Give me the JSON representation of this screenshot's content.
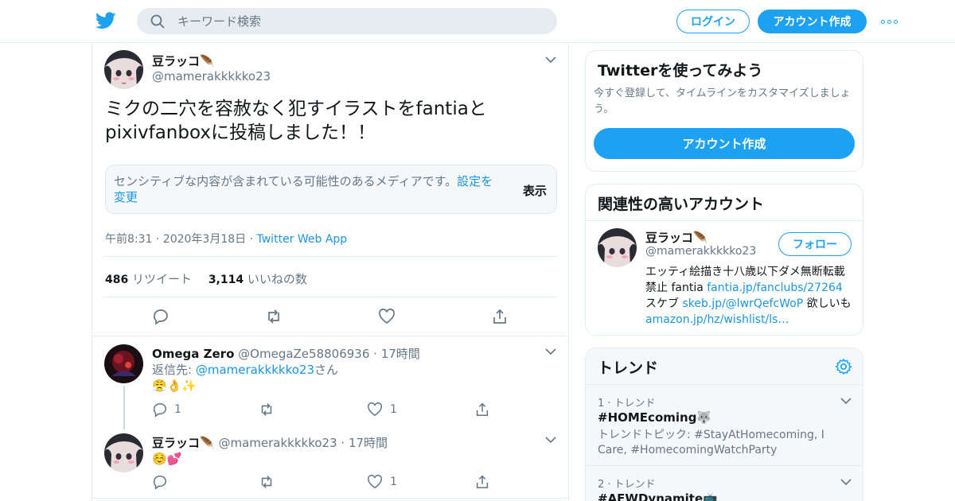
{
  "topbar": {
    "search_placeholder": "キーワード検索",
    "login_label": "ログイン",
    "signup_label": "アカウント作成",
    "accent": "#1da1f2"
  },
  "tweet": {
    "name": "豆ラッコ🪶",
    "handle": "@mamerakkkkko23",
    "text": "ミクの二穴を容赦なく犯すイラストをfantiaとpixivfanboxに投稿しました！！",
    "sensitive_msg": "センシティブな内容が含まれている可能性のあるメディアです。",
    "sensitive_link": "設定を変更",
    "sensitive_show": "表示",
    "time": "午前8:31 · 2020年3月18日",
    "via": "Twitter Web App",
    "retweets": "486",
    "retweets_label": "リツイート",
    "likes": "3,114",
    "likes_label": "いいねの数"
  },
  "replies": [
    {
      "name": "Omega Zero",
      "handle": "@OmegaZe58806936",
      "time": "17時間",
      "reply_prefix": "返信先: ",
      "reply_to": "@mamerakkkkko23",
      "reply_suffix": "さん",
      "text": "😤👌✨",
      "reply_count": "1",
      "like_count": "1"
    },
    {
      "name": "豆ラッコ🪶",
      "handle": "@mamerakkkkko23",
      "time": "17時間",
      "text": "☺️💕",
      "like_count": "1"
    }
  ],
  "signup_card": {
    "title": "Twitterを使ってみよう",
    "sub": "今すぐ登録して、タイムラインをカスタマイズしましょう。",
    "button": "アカウント作成"
  },
  "related": {
    "title": "関連性の高いアカウント",
    "name": "豆ラッコ🪶",
    "handle": "@mamerakkkkko23",
    "follow": "フォロー",
    "bio_1": "エッティ絵描き十八歳以下ダメ無断転載禁止 fantia ",
    "bio_link_1": "fantia.jp/fanclubs/27264",
    "bio_2": " スケブ ",
    "bio_link_2": "skeb.jp/@lwrQefcWoP",
    "bio_3": " 欲しいも ",
    "bio_link_3": "amazon.jp/hz/wishlist/ls…"
  },
  "trends": {
    "title": "トレンド",
    "items": [
      {
        "rank": "1 · トレンド",
        "tag": "#HOMEcoming🐺",
        "desc": "トレンドトピック: #StayAtHomecoming, I Care, #HomecomingWatchParty"
      },
      {
        "rank": "2 · トレンド",
        "tag": "#AEWDynamite📺"
      }
    ]
  }
}
